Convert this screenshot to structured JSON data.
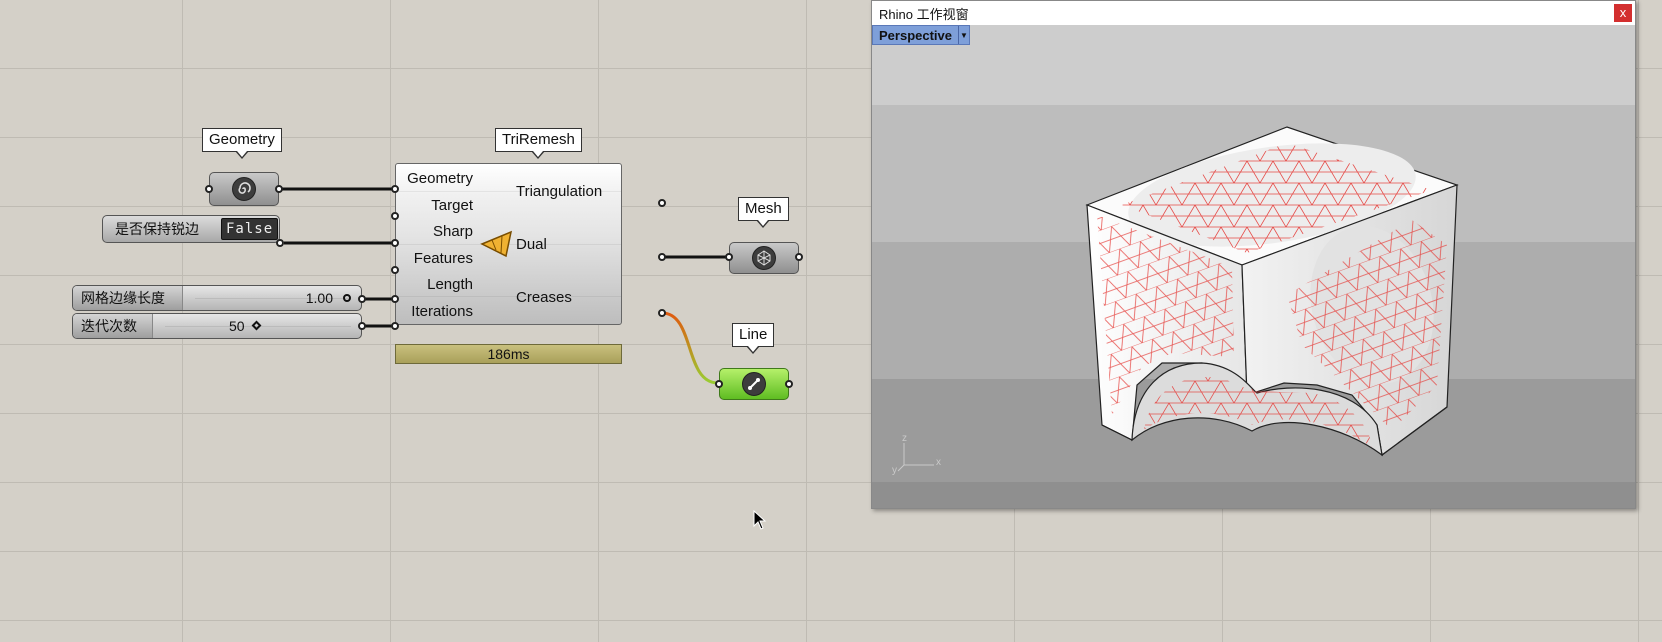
{
  "canvas": {
    "callouts": {
      "geometry": "Geometry",
      "triremesh": "TriRemesh",
      "mesh": "Mesh",
      "line": "Line"
    },
    "toggle": {
      "label": "是否保持锐边",
      "value": "False"
    },
    "sliders": [
      {
        "label": "网格边缘长度",
        "value": "1.00"
      },
      {
        "label": "迭代次数",
        "value": "50"
      }
    ],
    "component": {
      "inputs": [
        "Geometry",
        "Target",
        "Sharp",
        "Features",
        "Length",
        "Iterations"
      ],
      "outputs": [
        "Triangulation",
        "Dual",
        "Creases"
      ],
      "timer": "186ms"
    }
  },
  "rhino": {
    "title": "Rhino 工作视窗",
    "close": "x",
    "viewport": "Perspective",
    "axes": {
      "x": "x",
      "y": "y",
      "z": "z"
    }
  },
  "colors": {
    "canvas": "#d4d0c8",
    "wire": "#111111",
    "creases_wire_start": "#e05a10",
    "creases_wire_end": "#9acd32",
    "mesh_lines": "#e53935",
    "viewport_tab": "#7e9fd9"
  }
}
